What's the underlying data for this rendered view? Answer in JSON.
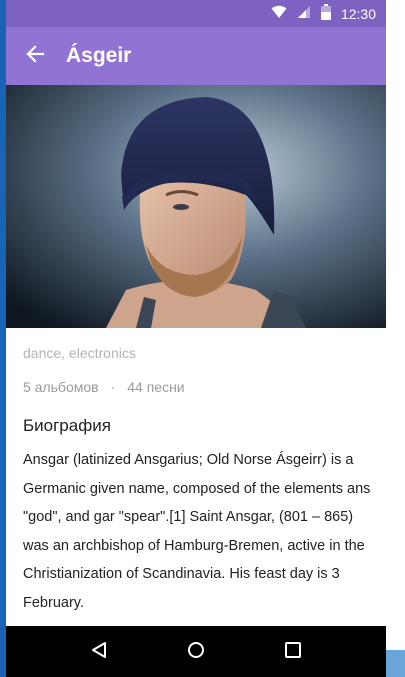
{
  "status_bar": {
    "time": "12:30",
    "icons": [
      "wifi-icon",
      "signal-icon",
      "battery-icon"
    ]
  },
  "app_bar": {
    "title": "Ásgeir",
    "back_icon": "arrow-left-icon"
  },
  "artist": {
    "genres": "dance, electronics",
    "albums": "5 альбомов",
    "separator": "·",
    "songs": "44 песни"
  },
  "biography": {
    "heading": "Биография",
    "text": "Ansgar (latinized Ansgarius; Old Norse Ásgeirr) is a Germanic given name, composed of the elements ans \"god\", and gar \"spear\".[1] Saint Ansgar, (801 – 865) was an archbishop of Hamburg-Bremen, active in the Christianization of Scandinavia. His feast day is 3 February."
  },
  "nav_bar": {
    "icons": [
      "back-triangle-icon",
      "home-circle-icon",
      "recents-square-icon"
    ]
  },
  "colors": {
    "status_bar": "#7d62c1",
    "app_bar": "#9173d3",
    "nav_bar": "#000000"
  }
}
